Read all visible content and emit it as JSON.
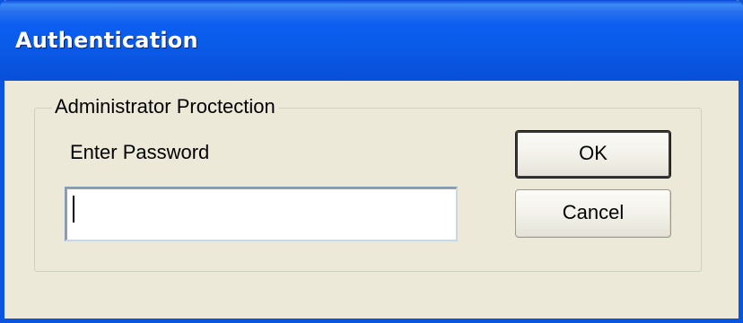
{
  "window": {
    "title": "Authentication"
  },
  "group": {
    "label": "Administrator Proctection"
  },
  "password": {
    "label": "Enter Password",
    "value": ""
  },
  "buttons": {
    "ok_label": "OK",
    "cancel_label": "Cancel"
  },
  "colors": {
    "titlebar": "#0a54e0",
    "dialog_background": "#ece9d8",
    "title_text": "#ffffff"
  }
}
